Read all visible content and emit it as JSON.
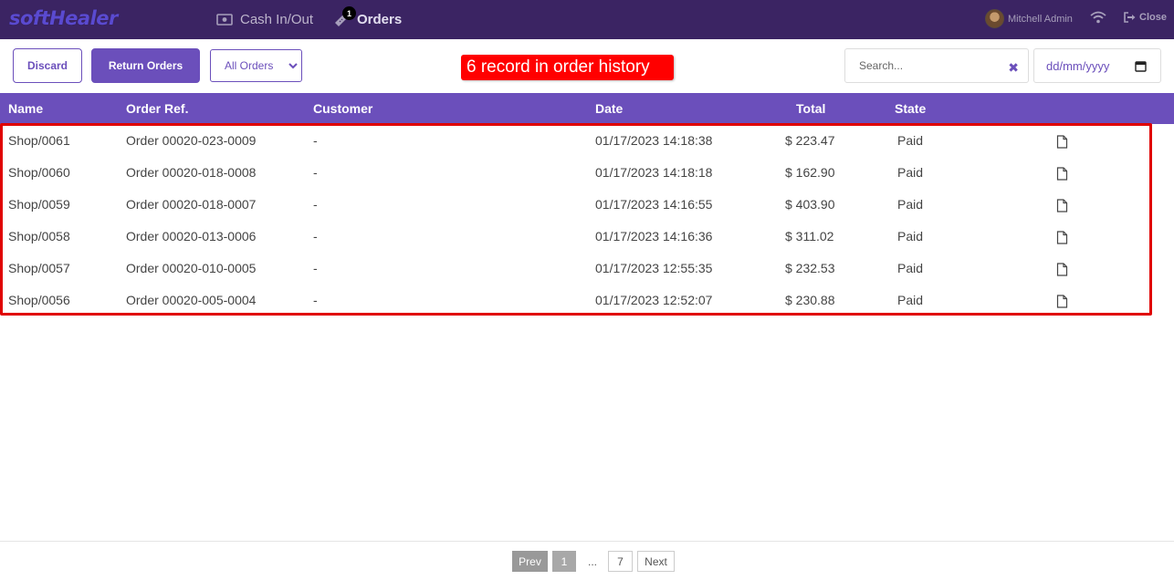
{
  "app": {
    "logo_text": "softHealer"
  },
  "topbar": {
    "nav": [
      {
        "label": "Cash In/Out",
        "icon": "cash-icon"
      },
      {
        "label": "Orders",
        "icon": "ticket-icon",
        "badge": "1"
      }
    ],
    "user_name": "Mitchell Admin",
    "close_label": "Close"
  },
  "controls": {
    "discard_label": "Discard",
    "return_orders_label": "Return Orders",
    "filter_selected": "All Orders",
    "search_placeholder": "Search...",
    "date_placeholder": "dd/mm/yyyy"
  },
  "annotation": {
    "text": "6 record in order history"
  },
  "table": {
    "headers": {
      "name": "Name",
      "order_ref": "Order Ref.",
      "customer": "Customer",
      "date": "Date",
      "total": "Total",
      "state": "State"
    },
    "rows": [
      {
        "name": "Shop/0061",
        "order_ref": "Order 00020-023-0009",
        "customer": "-",
        "date": "01/17/2023 14:18:38",
        "total": "$ 223.47",
        "state": "Paid"
      },
      {
        "name": "Shop/0060",
        "order_ref": "Order 00020-018-0008",
        "customer": "-",
        "date": "01/17/2023 14:18:18",
        "total": "$ 162.90",
        "state": "Paid"
      },
      {
        "name": "Shop/0059",
        "order_ref": "Order 00020-018-0007",
        "customer": "-",
        "date": "01/17/2023 14:16:55",
        "total": "$ 403.90",
        "state": "Paid"
      },
      {
        "name": "Shop/0058",
        "order_ref": "Order 00020-013-0006",
        "customer": "-",
        "date": "01/17/2023 14:16:36",
        "total": "$ 311.02",
        "state": "Paid"
      },
      {
        "name": "Shop/0057",
        "order_ref": "Order 00020-010-0005",
        "customer": "-",
        "date": "01/17/2023 12:55:35",
        "total": "$ 232.53",
        "state": "Paid"
      },
      {
        "name": "Shop/0056",
        "order_ref": "Order 00020-005-0004",
        "customer": "-",
        "date": "01/17/2023 12:52:07",
        "total": "$ 230.88",
        "state": "Paid"
      }
    ]
  },
  "pagination": {
    "prev_label": "Prev",
    "current": "1",
    "ellipsis": "...",
    "last": "7",
    "next_label": "Next"
  },
  "colors": {
    "topbar": "#3b2463",
    "accent": "#6b4fbb",
    "highlight": "#ff0000"
  }
}
